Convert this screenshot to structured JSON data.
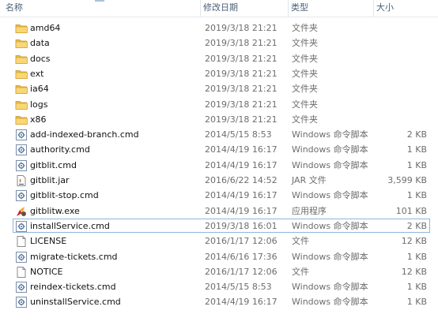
{
  "columns": {
    "name": "名称",
    "date": "修改日期",
    "type": "类型",
    "size": "大小"
  },
  "files": [
    {
      "name": "amd64",
      "date": "2019/3/18 21:21",
      "type": "文件夹",
      "size": "",
      "icon": "folder-icon"
    },
    {
      "name": "data",
      "date": "2019/3/18 21:21",
      "type": "文件夹",
      "size": "",
      "icon": "folder-icon"
    },
    {
      "name": "docs",
      "date": "2019/3/18 21:21",
      "type": "文件夹",
      "size": "",
      "icon": "folder-icon"
    },
    {
      "name": "ext",
      "date": "2019/3/18 21:21",
      "type": "文件夹",
      "size": "",
      "icon": "folder-icon"
    },
    {
      "name": "ia64",
      "date": "2019/3/18 21:21",
      "type": "文件夹",
      "size": "",
      "icon": "folder-icon"
    },
    {
      "name": "logs",
      "date": "2019/3/18 21:21",
      "type": "文件夹",
      "size": "",
      "icon": "folder-icon"
    },
    {
      "name": "x86",
      "date": "2019/3/18 21:21",
      "type": "文件夹",
      "size": "",
      "icon": "folder-icon"
    },
    {
      "name": "add-indexed-branch.cmd",
      "date": "2014/5/15 8:53",
      "type": "Windows 命令脚本",
      "size": "2 KB",
      "icon": "cmd-script-icon"
    },
    {
      "name": "authority.cmd",
      "date": "2014/4/19 16:17",
      "type": "Windows 命令脚本",
      "size": "1 KB",
      "icon": "cmd-script-icon"
    },
    {
      "name": "gitblit.cmd",
      "date": "2014/4/19 16:17",
      "type": "Windows 命令脚本",
      "size": "1 KB",
      "icon": "cmd-script-icon"
    },
    {
      "name": "gitblit.jar",
      "date": "2016/6/22 14:52",
      "type": "JAR 文件",
      "size": "3,599 KB",
      "icon": "jar-file-icon"
    },
    {
      "name": "gitblit-stop.cmd",
      "date": "2014/4/19 16:17",
      "type": "Windows 命令脚本",
      "size": "1 KB",
      "icon": "cmd-script-icon"
    },
    {
      "name": "gitblitw.exe",
      "date": "2014/4/19 16:17",
      "type": "应用程序",
      "size": "101 KB",
      "icon": "application-icon"
    },
    {
      "name": "installService.cmd",
      "date": "2019/3/18 16:01",
      "type": "Windows 命令脚本",
      "size": "2 KB",
      "icon": "cmd-script-icon",
      "selected": true
    },
    {
      "name": "LICENSE",
      "date": "2016/1/17 12:06",
      "type": "文件",
      "size": "12 KB",
      "icon": "blank-file-icon"
    },
    {
      "name": "migrate-tickets.cmd",
      "date": "2014/6/16 17:36",
      "type": "Windows 命令脚本",
      "size": "1 KB",
      "icon": "cmd-script-icon"
    },
    {
      "name": "NOTICE",
      "date": "2016/1/17 12:06",
      "type": "文件",
      "size": "12 KB",
      "icon": "blank-file-icon"
    },
    {
      "name": "reindex-tickets.cmd",
      "date": "2014/5/15 8:53",
      "type": "Windows 命令脚本",
      "size": "1 KB",
      "icon": "cmd-script-icon"
    },
    {
      "name": "uninstallService.cmd",
      "date": "2014/4/19 16:17",
      "type": "Windows 命令脚本",
      "size": "1 KB",
      "icon": "cmd-script-icon"
    }
  ]
}
